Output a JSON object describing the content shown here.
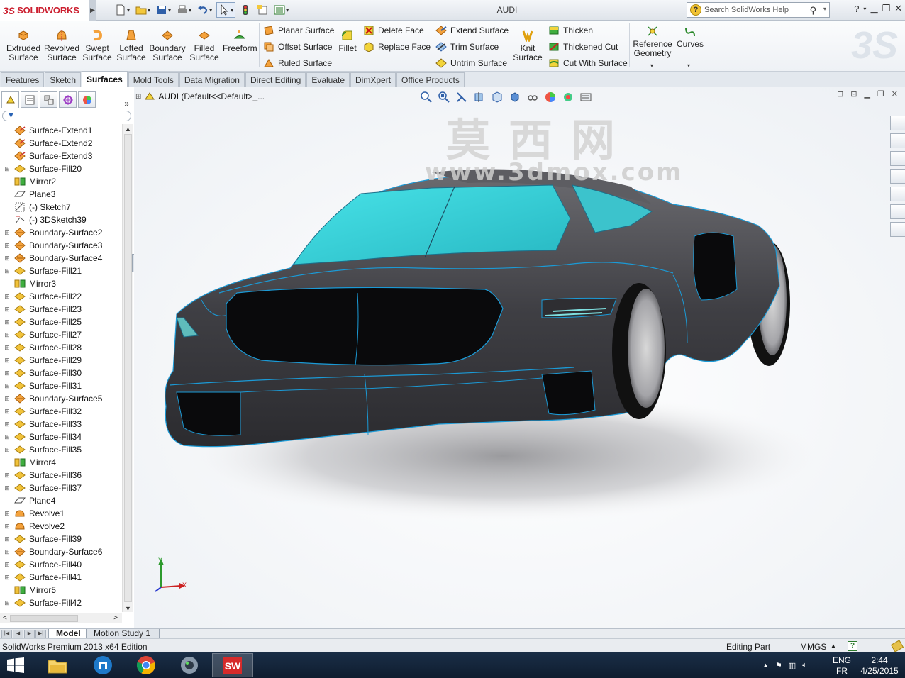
{
  "app": {
    "logo_mark": "3S",
    "logo_text": "SOLIDWORKS",
    "title": "AUDI",
    "search_placeholder": "Search SolidWorks Help"
  },
  "ribbon": {
    "big_buttons": [
      {
        "label": "Extruded\nSurface",
        "icon": "extruded-surface-icon"
      },
      {
        "label": "Revolved\nSurface",
        "icon": "revolved-surface-icon"
      },
      {
        "label": "Swept\nSurface",
        "icon": "swept-surface-icon"
      },
      {
        "label": "Lofted\nSurface",
        "icon": "lofted-surface-icon"
      },
      {
        "label": "Boundary\nSurface",
        "icon": "boundary-surface-icon"
      },
      {
        "label": "Filled\nSurface",
        "icon": "filled-surface-icon"
      },
      {
        "label": "Freeform",
        "icon": "freeform-icon"
      }
    ],
    "group1": [
      "Planar Surface",
      "Offset Surface",
      "Ruled Surface"
    ],
    "fillet": "Fillet",
    "group2": [
      "Delete Face",
      "Replace Face"
    ],
    "group3": [
      "Extend Surface",
      "Trim Surface",
      "Untrim Surface"
    ],
    "knit": "Knit\nSurface",
    "group4": [
      "Thicken",
      "Thickened Cut",
      "Cut With Surface"
    ],
    "reference_geometry": "Reference\nGeometry",
    "curves": "Curves"
  },
  "tabs": [
    "Features",
    "Sketch",
    "Surfaces",
    "Mold Tools",
    "Data Migration",
    "Direct Editing",
    "Evaluate",
    "DimXpert",
    "Office Products"
  ],
  "active_tab": "Surfaces",
  "feature_tree": {
    "root": "AUDI  (Default<<Default>_...",
    "items": [
      {
        "label": "Surface-Extend1",
        "icon": "extend-surface-icon",
        "expand": false
      },
      {
        "label": "Surface-Extend2",
        "icon": "extend-surface-icon",
        "expand": false
      },
      {
        "label": "Surface-Extend3",
        "icon": "extend-surface-icon",
        "expand": false
      },
      {
        "label": "Surface-Fill20",
        "icon": "fill-surface-icon",
        "expand": true
      },
      {
        "label": "Mirror2",
        "icon": "mirror-icon",
        "expand": false
      },
      {
        "label": "Plane3",
        "icon": "plane-icon",
        "expand": false
      },
      {
        "label": "(-) Sketch7",
        "icon": "sketch-icon",
        "expand": false
      },
      {
        "label": "(-) 3DSketch39",
        "icon": "3d-sketch-icon",
        "expand": false
      },
      {
        "label": "Boundary-Surface2",
        "icon": "boundary-surface-icon",
        "expand": true
      },
      {
        "label": "Boundary-Surface3",
        "icon": "boundary-surface-icon",
        "expand": true
      },
      {
        "label": "Boundary-Surface4",
        "icon": "boundary-surface-icon",
        "expand": true
      },
      {
        "label": "Surface-Fill21",
        "icon": "fill-surface-icon",
        "expand": true
      },
      {
        "label": "Mirror3",
        "icon": "mirror-icon",
        "expand": false
      },
      {
        "label": "Surface-Fill22",
        "icon": "fill-surface-icon",
        "expand": true
      },
      {
        "label": "Surface-Fill23",
        "icon": "fill-surface-icon",
        "expand": true
      },
      {
        "label": "Surface-Fill25",
        "icon": "fill-surface-icon",
        "expand": true
      },
      {
        "label": "Surface-Fill27",
        "icon": "fill-surface-icon",
        "expand": true
      },
      {
        "label": "Surface-Fill28",
        "icon": "fill-surface-icon",
        "expand": true
      },
      {
        "label": "Surface-Fill29",
        "icon": "fill-surface-icon",
        "expand": true
      },
      {
        "label": "Surface-Fill30",
        "icon": "fill-surface-icon",
        "expand": true
      },
      {
        "label": "Surface-Fill31",
        "icon": "fill-surface-icon",
        "expand": true
      },
      {
        "label": "Boundary-Surface5",
        "icon": "boundary-surface-icon",
        "expand": true
      },
      {
        "label": "Surface-Fill32",
        "icon": "fill-surface-icon",
        "expand": true
      },
      {
        "label": "Surface-Fill33",
        "icon": "fill-surface-icon",
        "expand": true
      },
      {
        "label": "Surface-Fill34",
        "icon": "fill-surface-icon",
        "expand": true
      },
      {
        "label": "Surface-Fill35",
        "icon": "fill-surface-icon",
        "expand": true
      },
      {
        "label": "Mirror4",
        "icon": "mirror-icon",
        "expand": false
      },
      {
        "label": "Surface-Fill36",
        "icon": "fill-surface-icon",
        "expand": true
      },
      {
        "label": "Surface-Fill37",
        "icon": "fill-surface-icon",
        "expand": true
      },
      {
        "label": "Plane4",
        "icon": "plane-icon",
        "expand": false
      },
      {
        "label": "Revolve1",
        "icon": "revolve-surface-icon",
        "expand": true
      },
      {
        "label": "Revolve2",
        "icon": "revolve-surface-icon",
        "expand": true
      },
      {
        "label": "Surface-Fill39",
        "icon": "fill-surface-icon",
        "expand": true
      },
      {
        "label": "Boundary-Surface6",
        "icon": "boundary-surface-icon",
        "expand": true
      },
      {
        "label": "Surface-Fill40",
        "icon": "fill-surface-icon",
        "expand": true
      },
      {
        "label": "Surface-Fill41",
        "icon": "fill-surface-icon",
        "expand": true
      },
      {
        "label": "Mirror5",
        "icon": "mirror-icon",
        "expand": false
      },
      {
        "label": "Surface-Fill42",
        "icon": "fill-surface-icon",
        "expand": true
      }
    ]
  },
  "watermark": {
    "chars": "莫西网",
    "url": "www.3dmox.com"
  },
  "axes": {
    "x": "X",
    "y": "Y"
  },
  "bottom_tabs": [
    "Model",
    "Motion Study 1"
  ],
  "status": {
    "edition": "SolidWorks Premium 2013 x64 Edition",
    "mode": "Editing Part",
    "units": "MMGS"
  },
  "taskbar": {
    "apps": [
      "file-explorer-icon",
      "store-icon",
      "chrome-icon",
      "speaker-app-icon",
      "solidworks-icon"
    ],
    "lang_top": "ENG",
    "lang_bottom": "FR",
    "time": "2:44",
    "date": "4/25/2015"
  },
  "colors": {
    "brand_red": "#cc1f2f",
    "glass": "#3ecdd6",
    "body": "#4a4a4e",
    "edge": "#1b9ad6"
  }
}
